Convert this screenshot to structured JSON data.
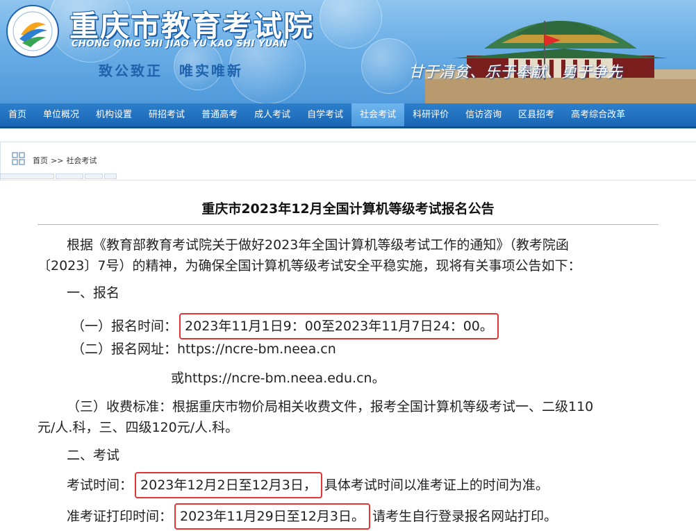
{
  "header": {
    "title": "重庆市教育考试院",
    "pinyin": "CHONG QING SHI JIAO YU KAO SHI YUAN",
    "motto_left": "致公致正",
    "motto_right": "唯实唯新",
    "slogan": "甘于清贫、乐于奉献、勇于争先"
  },
  "nav": {
    "items": [
      "首页",
      "单位概况",
      "机构设置",
      "研招考试",
      "普通高考",
      "成人考试",
      "自学考试",
      "社会考试",
      "科研评价",
      "信访咨询",
      "区县招考",
      "高考综合改革"
    ],
    "active_index": 7
  },
  "breadcrumb": {
    "home": "首页",
    "separator": ">>",
    "current": "社会考试"
  },
  "article": {
    "title": "重庆市2023年12月全国计算机等级考试报名公告",
    "intro_line1": "根据《教育部教育考试院关于做好2023年全国计算机等级考试工作的通知》（教考院函",
    "intro_line2": "〔2023〕7号）的精神，为确保全国计算机等级考试安全平稳实施，现将有关事项公告如下：",
    "section1": "一、报名",
    "reg_time_label": "（一）报名时间：",
    "reg_time_value": "2023年11月1日9：00至2023年11月7日24：00。",
    "reg_url_label": "（二）报名网址：",
    "reg_url_value": "https://ncre-bm.neea.cn",
    "reg_url_alt": "或https://ncre-bm.neea.edu.cn。",
    "fee_line1": "（三）收费标准：根据重庆市物价局相关收费文件，报考全国计算机等级考试一、二级110",
    "fee_line2": "元/人.科，三、四级120元/人.科。",
    "section2": "二、考试",
    "exam_time_label": "考试时间：",
    "exam_time_value": "2023年12月2日至12月3日，",
    "exam_time_note": "具体考试时间以准考证上的时间为准。",
    "ticket_label": "准考证打印时间：",
    "ticket_value": "2023年11月29日至12月3日。",
    "ticket_note": "请考生自行登录报名网站打印。"
  },
  "colors": {
    "nav_bg": "#1a66b4",
    "nav_active": "#4c9ade",
    "highlight_border": "#e53333",
    "title_text": "#111111"
  }
}
